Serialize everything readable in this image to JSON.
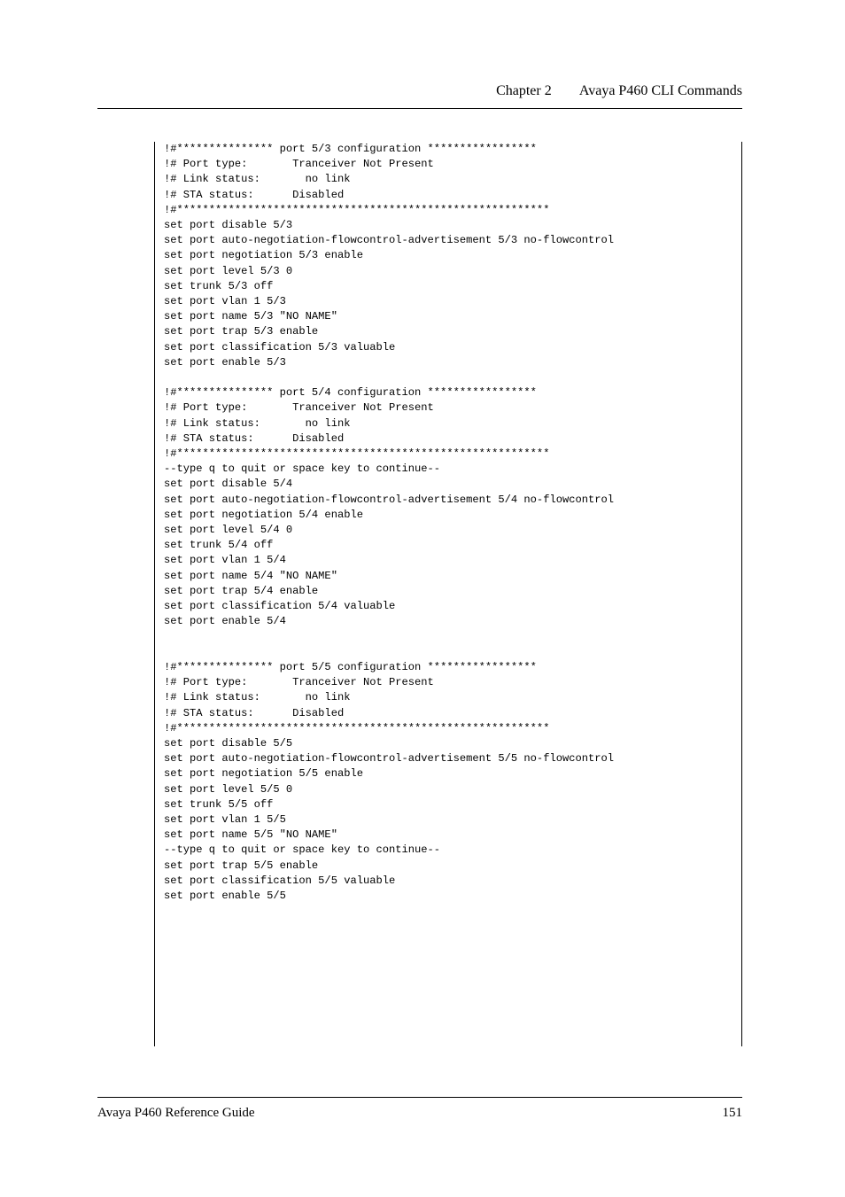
{
  "header": {
    "chapter": "Chapter 2",
    "title": "Avaya P460 CLI Commands"
  },
  "code": "!#*************** port 5/3 configuration *****************\n!# Port type:       Tranceiver Not Present\n!# Link status:       no link\n!# STA status:      Disabled\n!#**********************************************************\nset port disable 5/3\nset port auto-negotiation-flowcontrol-advertisement 5/3 no-flowcontrol\nset port negotiation 5/3 enable\nset port level 5/3 0\nset trunk 5/3 off\nset port vlan 1 5/3\nset port name 5/3 \"NO NAME\"\nset port trap 5/3 enable\nset port classification 5/3 valuable\nset port enable 5/3\n\n!#*************** port 5/4 configuration *****************\n!# Port type:       Tranceiver Not Present\n!# Link status:       no link\n!# STA status:      Disabled\n!#**********************************************************\n--type q to quit or space key to continue--\nset port disable 5/4\nset port auto-negotiation-flowcontrol-advertisement 5/4 no-flowcontrol\nset port negotiation 5/4 enable\nset port level 5/4 0\nset trunk 5/4 off\nset port vlan 1 5/4\nset port name 5/4 \"NO NAME\"\nset port trap 5/4 enable\nset port classification 5/4 valuable\nset port enable 5/4\n\n\n!#*************** port 5/5 configuration *****************\n!# Port type:       Tranceiver Not Present\n!# Link status:       no link\n!# STA status:      Disabled\n!#**********************************************************\nset port disable 5/5\nset port auto-negotiation-flowcontrol-advertisement 5/5 no-flowcontrol\nset port negotiation 5/5 enable\nset port level 5/5 0\nset trunk 5/5 off\nset port vlan 1 5/5\nset port name 5/5 \"NO NAME\"\n--type q to quit or space key to continue--\nset port trap 5/5 enable\nset port classification 5/5 valuable\nset port enable 5/5\n",
  "footer": {
    "guide": "Avaya P460 Reference Guide",
    "page": "151"
  }
}
